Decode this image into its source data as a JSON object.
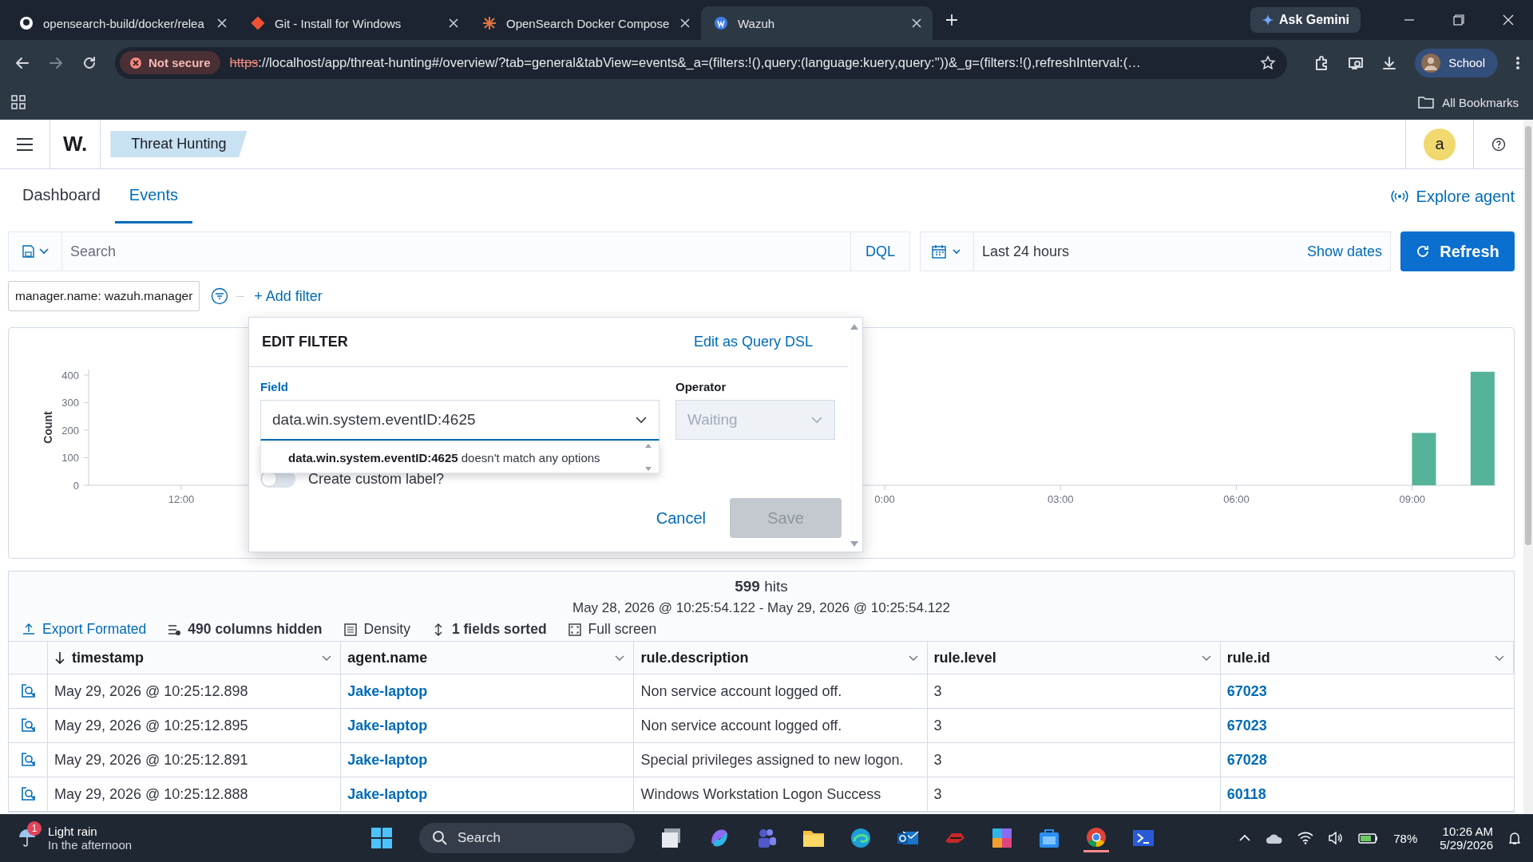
{
  "browser": {
    "tabs": [
      {
        "title": "opensearch-build/docker/relea",
        "selected": false
      },
      {
        "title": "Git - Install for Windows",
        "selected": false
      },
      {
        "title": "OpenSearch Docker Compose",
        "selected": false
      },
      {
        "title": "Wazuh",
        "selected": true
      }
    ],
    "gemini_button": "Ask Gemini",
    "security_chip": "Not secure",
    "url_scheme": "https",
    "url_rest": "://localhost/app/threat-hunting#/overview/?tab=general&tabView=events&_a=(filters:!(),query:(language:kuery,query:''))&_g=(filters:!(),refreshInterval:(…",
    "profile": "School",
    "bookmarks": "All Bookmarks"
  },
  "app": {
    "logo": "W.",
    "breadcrumb": "Threat Hunting",
    "avatar": "a",
    "tabs": [
      {
        "label": "Dashboard",
        "selected": false
      },
      {
        "label": "Events",
        "selected": true
      }
    ],
    "explore_agent": "Explore agent"
  },
  "query_bar": {
    "placeholder": "Search",
    "language": "DQL",
    "time_range": "Last 24 hours",
    "show_dates": "Show dates",
    "refresh": "Refresh"
  },
  "filters": [
    {
      "label": "manager.name: wazuh.manager"
    }
  ],
  "add_filter": "+ Add filter",
  "chart": {
    "chart_data": {
      "type": "bar",
      "ylabel": "Count",
      "x": [
        9.2,
        10.2
      ],
      "values": [
        190,
        412
      ],
      "xlim": [
        -13.58,
        10.42
      ],
      "ylim": [
        0,
        420
      ],
      "yticks": [
        0,
        100,
        200,
        300,
        400
      ],
      "xticks": [
        {
          "value": -12,
          "label": "12:00"
        },
        {
          "value": 0,
          "label": "0:00"
        },
        {
          "value": 3,
          "label": "03:00"
        },
        {
          "value": 6,
          "label": "06:00"
        },
        {
          "value": 9,
          "label": "09:00"
        }
      ]
    }
  },
  "edit_filter": {
    "title": "EDIT FILTER",
    "query_dsl_link": "Edit as Query DSL",
    "field_label": "Field",
    "field_value": "data.win.system.eventID:4625",
    "no_match": "**data.win.system.eventID:4625** doesn't match any options",
    "operator_label": "Operator",
    "operator_value": "Waiting",
    "operator_disabled": true,
    "custom_label": "Create custom label?",
    "custom_label_on": false,
    "cancel": "Cancel",
    "save": "Save",
    "save_disabled": true
  },
  "results": {
    "hits_count": "599",
    "hits_label": "hits",
    "range": "May 28, 2026 @ 10:25:54.122 - May 29, 2026 @ 10:25:54.122",
    "toolbar": [
      {
        "kind": "link",
        "label": "Export Formated"
      },
      {
        "kind": "bold",
        "label": "490 columns hidden"
      },
      {
        "kind": "plain",
        "label": "Density"
      },
      {
        "kind": "bold",
        "label": "1 fields sorted"
      },
      {
        "kind": "plain",
        "label": "Full screen"
      }
    ],
    "columns": [
      {
        "label": "timestamp",
        "sorted": true
      },
      {
        "label": "agent.name",
        "sorted": false
      },
      {
        "label": "rule.description",
        "sorted": false
      },
      {
        "label": "rule.level",
        "sorted": false
      },
      {
        "label": "rule.id",
        "sorted": false
      }
    ],
    "rows": [
      {
        "timestamp": "May 29, 2026 @ 10:25:12.898",
        "agent": "Jake-laptop",
        "description": "Non service account logged off.",
        "level": "3",
        "rule_id": "67023"
      },
      {
        "timestamp": "May 29, 2026 @ 10:25:12.895",
        "agent": "Jake-laptop",
        "description": "Non service account logged off.",
        "level": "3",
        "rule_id": "67023"
      },
      {
        "timestamp": "May 29, 2026 @ 10:25:12.891",
        "agent": "Jake-laptop",
        "description": "Special privileges assigned to new logon.",
        "level": "3",
        "rule_id": "67028"
      },
      {
        "timestamp": "May 29, 2026 @ 10:25:12.888",
        "agent": "Jake-laptop",
        "description": "Windows Workstation Logon Success",
        "level": "3",
        "rule_id": "60118"
      }
    ]
  },
  "taskbar": {
    "weather_badge": "1",
    "weather": "Light rain",
    "weather_detail": "In the afternoon",
    "search": "Search",
    "battery": "78%",
    "time": "10:26 AM",
    "date": "5/29/2026"
  }
}
